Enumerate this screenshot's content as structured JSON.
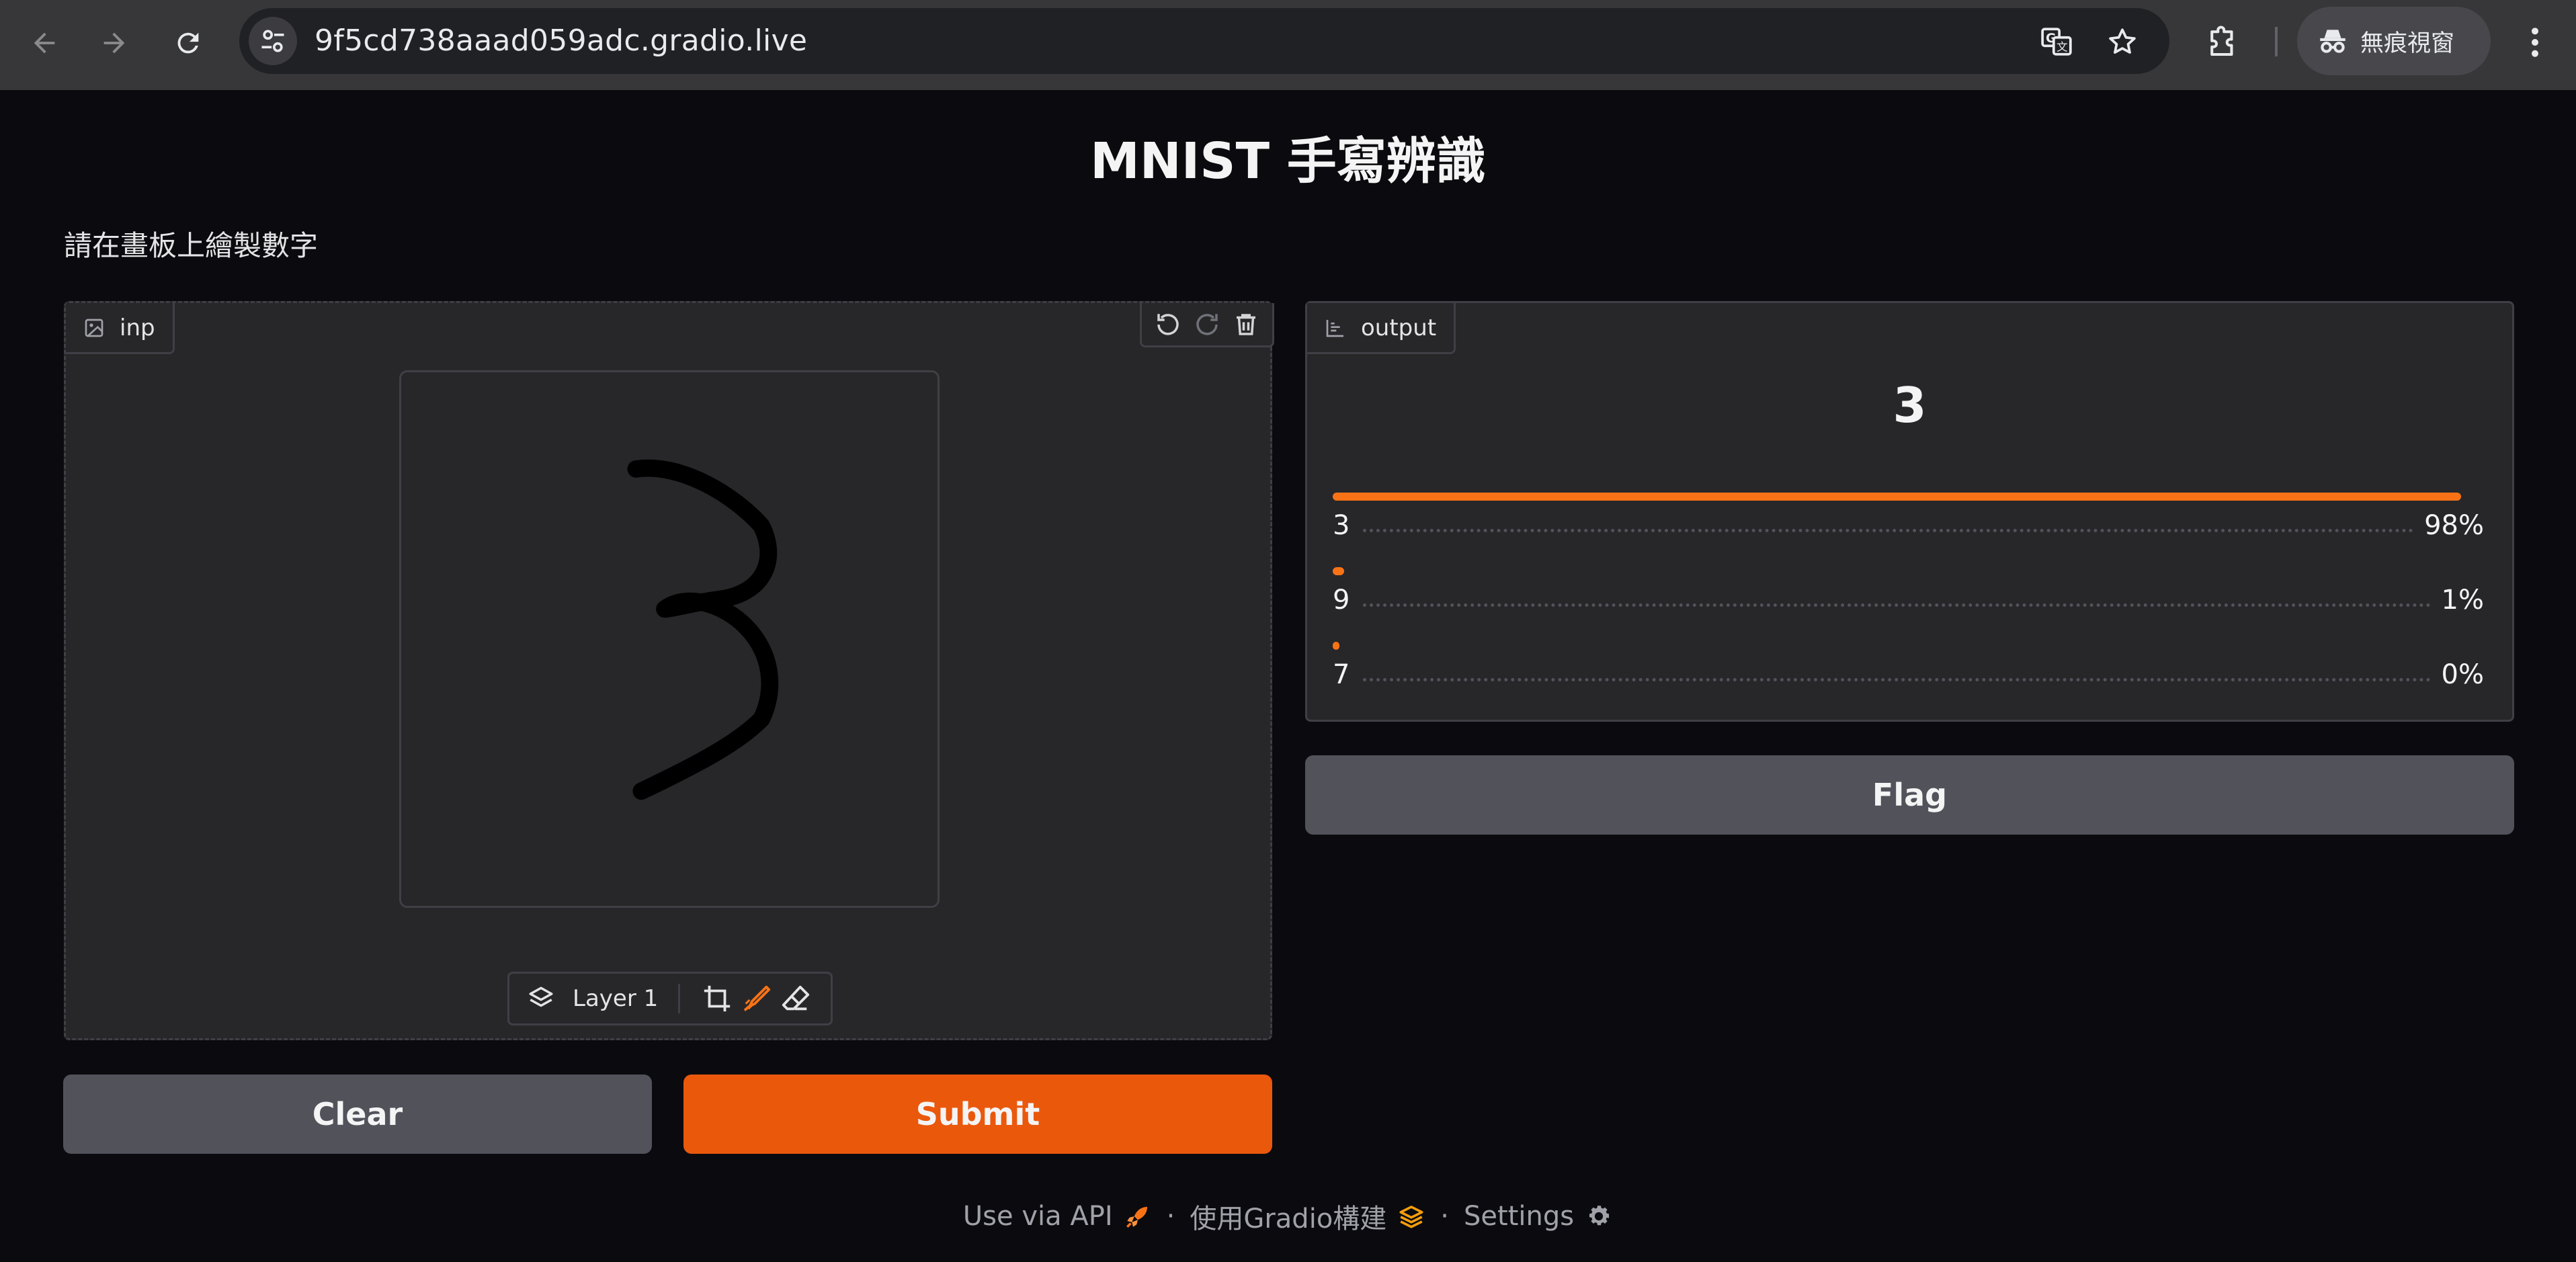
{
  "browser": {
    "url": "9f5cd738aaad059adc.gradio.live",
    "incognito_label": "無痕視窗"
  },
  "page": {
    "title": "MNIST 手寫辨識",
    "description": "請在畫板上繪製數字"
  },
  "input_panel": {
    "label": "inp",
    "layer_label": "Layer 1"
  },
  "output_panel": {
    "label": "output",
    "prediction": "3",
    "confidences": [
      {
        "label": "3",
        "value": 0.98,
        "percent": "98%"
      },
      {
        "label": "9",
        "value": 0.01,
        "percent": "1%"
      },
      {
        "label": "7",
        "value": 0.0,
        "percent": "0%"
      }
    ]
  },
  "buttons": {
    "clear": "Clear",
    "submit": "Submit",
    "flag": "Flag"
  },
  "footer": {
    "api": "Use via API",
    "built_with": "使用Gradio構建",
    "settings": "Settings",
    "separator": "·"
  },
  "colors": {
    "accent": "#ea580c",
    "bar": "#f97316",
    "background": "#0b0b0f",
    "panel": "#27272a"
  }
}
